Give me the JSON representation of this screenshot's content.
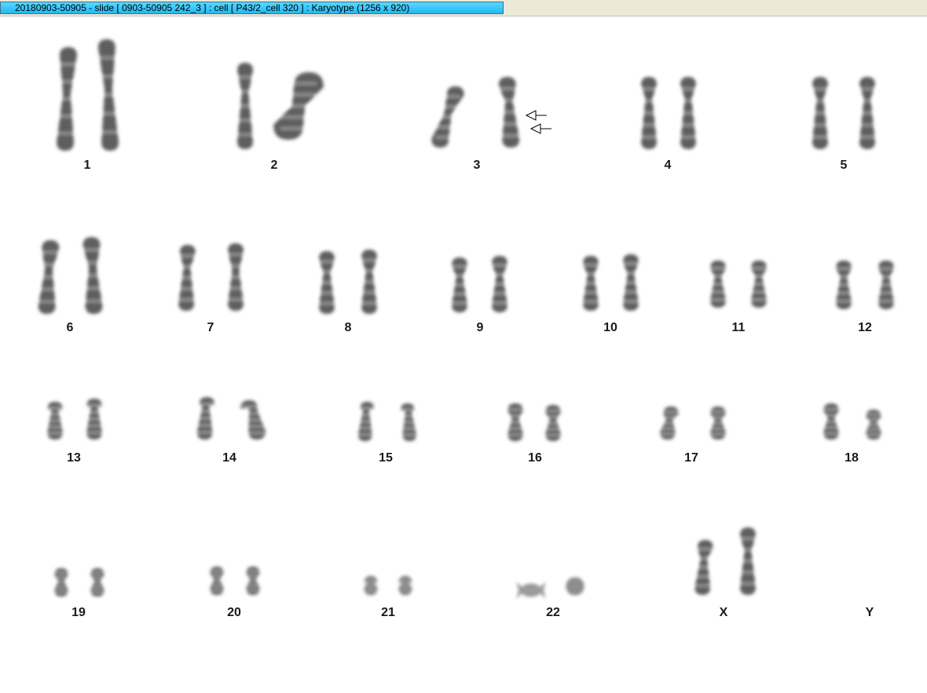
{
  "window": {
    "title": "20180903-50905 - slide [ 0903-50905 242_3 ] : cell [ P43/2_cell 320 ] : Karyotype  (1256 x 920)"
  },
  "colors": {
    "titlebar_bg": "#ece9d8",
    "title_tab": "#2ec6fb",
    "chromosome": "#3c3c3c",
    "label": "#1a1a1a",
    "canvas": "#ffffff"
  },
  "karyotype": {
    "pairs": [
      {
        "label": "1"
      },
      {
        "label": "2"
      },
      {
        "label": "3"
      },
      {
        "label": "4"
      },
      {
        "label": "5"
      },
      {
        "label": "6"
      },
      {
        "label": "7"
      },
      {
        "label": "8"
      },
      {
        "label": "9"
      },
      {
        "label": "10"
      },
      {
        "label": "11"
      },
      {
        "label": "12"
      },
      {
        "label": "13"
      },
      {
        "label": "14"
      },
      {
        "label": "15"
      },
      {
        "label": "16"
      },
      {
        "label": "17"
      },
      {
        "label": "18"
      },
      {
        "label": "19"
      },
      {
        "label": "20"
      },
      {
        "label": "21"
      },
      {
        "label": "22"
      },
      {
        "label": "X"
      },
      {
        "label": "Y"
      }
    ],
    "annotations": [
      {
        "pair": "3",
        "icon": "arrow-left-icon"
      },
      {
        "pair": "3",
        "icon": "arrow-left-icon"
      }
    ]
  }
}
